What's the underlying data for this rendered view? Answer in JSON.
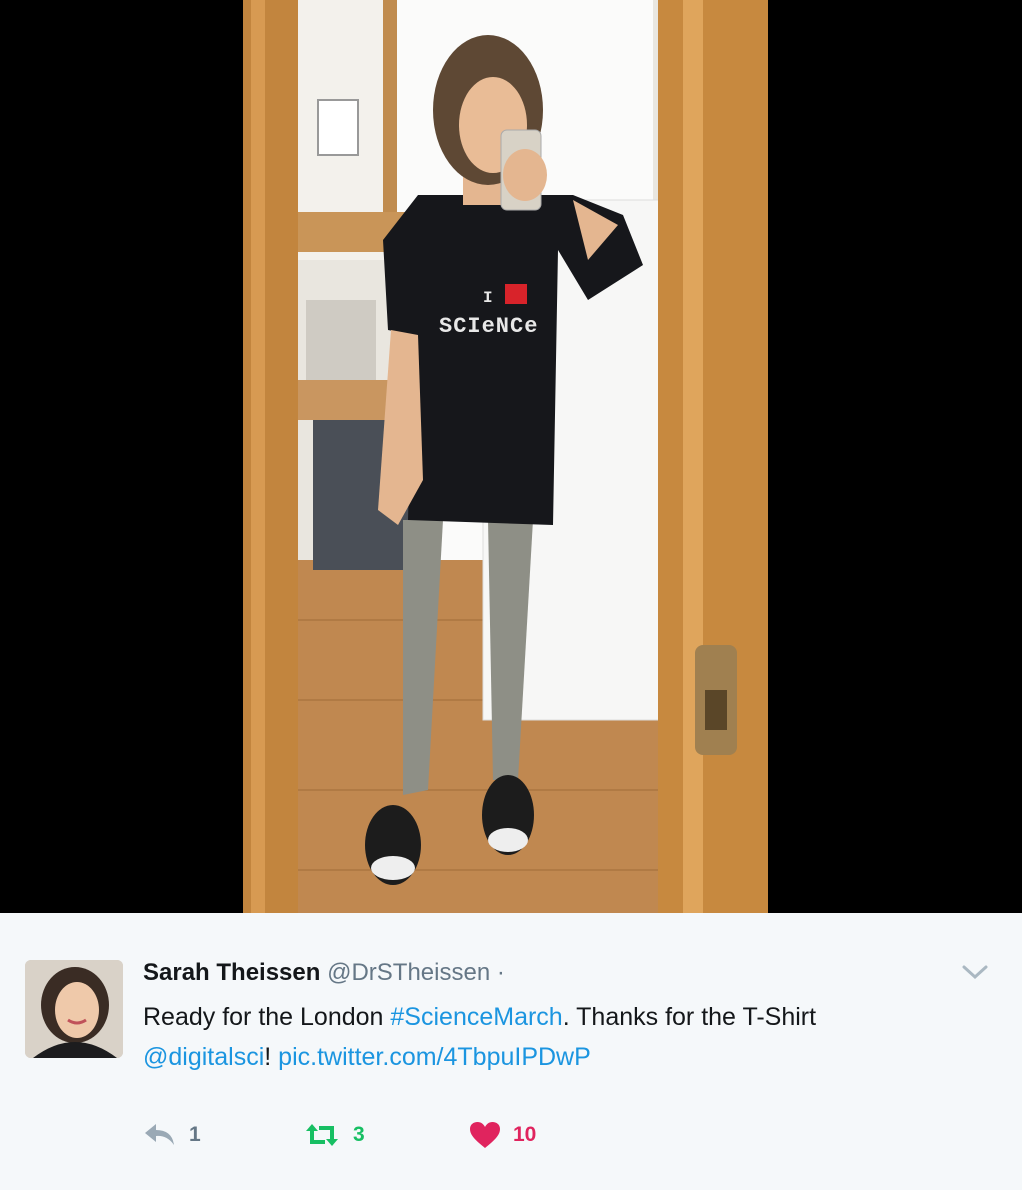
{
  "tweet": {
    "name": "Sarah Theissen",
    "handle": "@DrSTheissen",
    "separator": "·",
    "text_1": "Ready for the London ",
    "hashtag": "#ScienceMarch",
    "text_2": ". Thanks for the T-Shirt",
    "mention": "@digitalsci",
    "text_3": "! ",
    "pic_link": "pic.twitter.com/4TbpuIPDwP",
    "reply_count": "1",
    "retweet_count": "3",
    "like_count": "10"
  },
  "photo": {
    "shirt_line_1": "I",
    "shirt_line_2": "SCIeNCe"
  },
  "icons": {
    "caret": "chevron-down-icon",
    "reply": "reply-icon",
    "retweet": "retweet-icon",
    "like": "heart-icon"
  },
  "colors": {
    "link": "#1b95e0",
    "retweet": "#17bf63",
    "like": "#e0245e",
    "muted": "#657786",
    "background": "#f5f8fa"
  }
}
